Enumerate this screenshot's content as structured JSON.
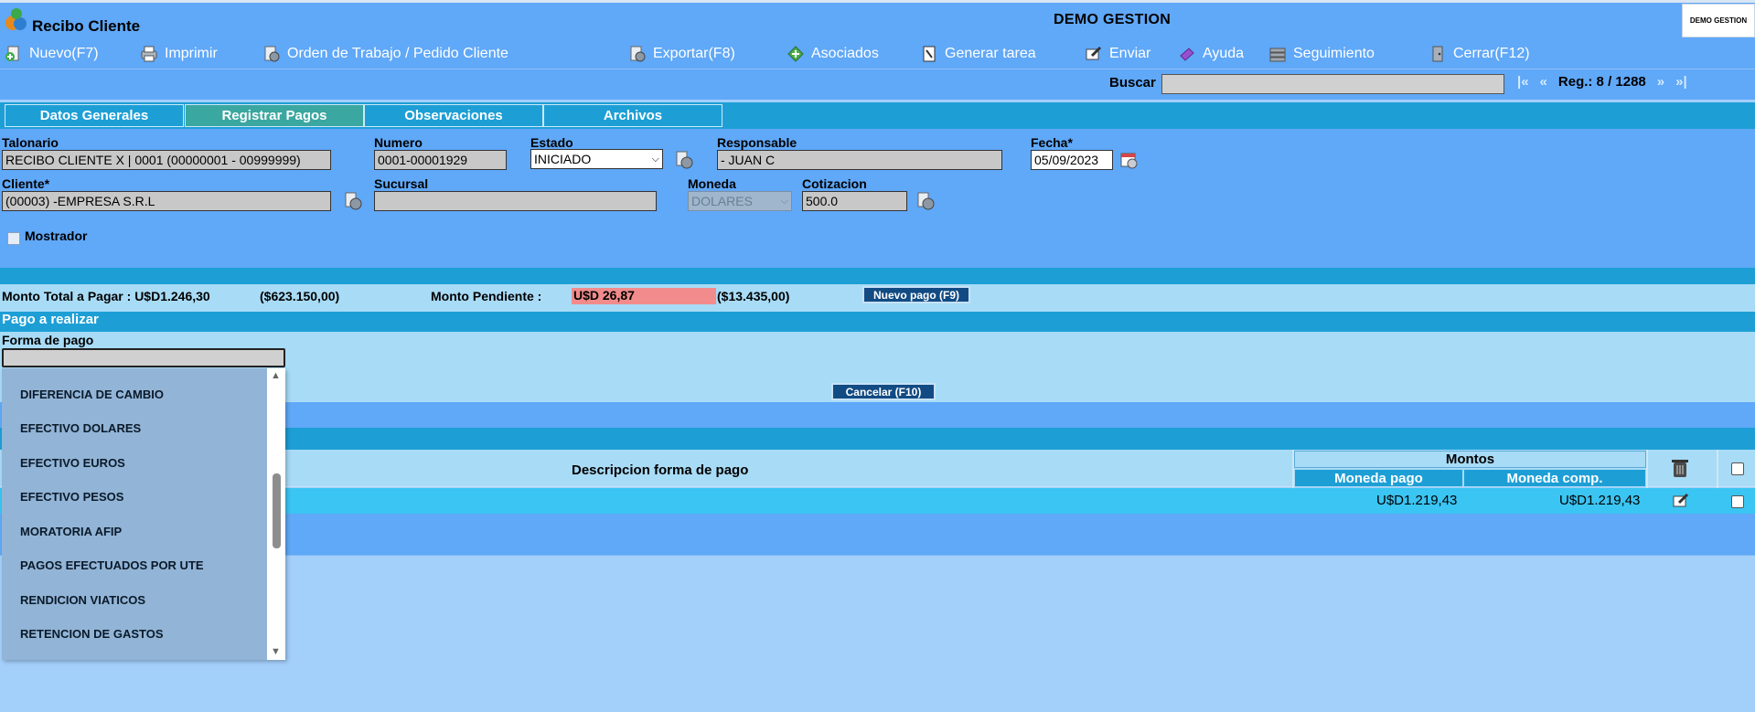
{
  "app": {
    "title": "Recibo Cliente",
    "brand": "DEMO GESTION",
    "logo_text": "DEMO GESTION"
  },
  "toolbar": {
    "nuevo": "Nuevo(F7)",
    "imprimir": "Imprimir",
    "orden": "Orden de Trabajo / Pedido Cliente",
    "exportar": "Exportar(F8)",
    "asociados": "Asociados",
    "generar_tarea": "Generar tarea",
    "enviar": "Enviar",
    "ayuda": "Ayuda",
    "seguimiento": "Seguimiento",
    "cerrar": "Cerrar(F12)"
  },
  "search": {
    "label": "Buscar",
    "value": "",
    "first": "|«",
    "prev": "«",
    "record": "Reg.: 8 / 1288",
    "next": "»",
    "last": "»|"
  },
  "tabs": [
    {
      "label": "Datos Generales",
      "active": false
    },
    {
      "label": "Registrar Pagos",
      "active": true
    },
    {
      "label": "Observaciones",
      "active": false
    },
    {
      "label": "Archivos",
      "active": false
    }
  ],
  "form": {
    "talonario_label": "Talonario",
    "talonario_value": "RECIBO CLIENTE X | 0001 (00000001 - 00999999)",
    "numero_label": "Numero",
    "numero_value": "0001-00001929",
    "estado_label": "Estado",
    "estado_value": "INICIADO",
    "responsable_label": "Responsable",
    "responsable_value": "- JUAN C",
    "fecha_label": "Fecha*",
    "fecha_value": "05/09/2023",
    "cliente_label": "Cliente*",
    "cliente_value": "(00003) -EMPRESA S.R.L",
    "sucursal_label": "Sucursal",
    "sucursal_value": "",
    "moneda_label": "Moneda",
    "moneda_value": "DOLARES",
    "cotizacion_label": "Cotizacion",
    "cotizacion_value": "500.0",
    "mostrador_label": "Mostrador"
  },
  "totals": {
    "monto_total_label": "Monto Total a Pagar : U$D1.246,30",
    "monto_total_pesos": "($623.150,00)",
    "monto_pendiente_label": "Monto Pendiente :",
    "monto_pendiente_value": "U$D 26,87",
    "monto_pendiente_pesos": "($13.435,00)",
    "nuevo_pago": "Nuevo pago (F9)"
  },
  "pago": {
    "title": "Pago a realizar",
    "forma_label": "Forma de pago",
    "forma_value": "",
    "cancelar": "Cancelar (F10)"
  },
  "table": {
    "col_descripcion": "Descripcion forma de pago",
    "col_montos": "Montos",
    "col_moneda_pago": "Moneda pago",
    "col_moneda_comp": "Moneda comp.",
    "rows": [
      {
        "moneda_pago": "U$D1.219,43",
        "moneda_comp": "U$D1.219,43"
      }
    ]
  },
  "dropdown": {
    "options": [
      "DIFERENCIA DE CAMBIO",
      "EFECTIVO DOLARES",
      "EFECTIVO EUROS",
      "EFECTIVO PESOS",
      "MORATORIA AFIP",
      "PAGOS EFECTUADOS POR UTE",
      "RENDICION VIATICOS",
      "RETENCION DE GASTOS"
    ]
  },
  "colors": {
    "header_blue": "#60a8f8",
    "tab_blue": "#1d9fd6",
    "tab_active": "#3aa7a0",
    "light_blue": "#a8dbf6",
    "row_cyan": "#3ac5f3",
    "pending_red": "#f28b8b",
    "dark_button": "#124b83"
  }
}
